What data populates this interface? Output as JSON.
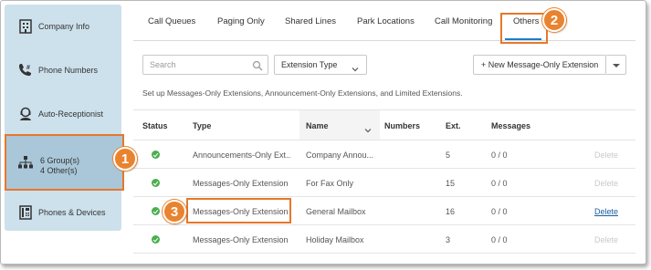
{
  "sidebar": {
    "items": [
      {
        "label": "Company Info",
        "icon": "building-icon"
      },
      {
        "label": "Phone Numbers",
        "icon": "phone-number-icon"
      },
      {
        "label": "Auto-Receptionist",
        "icon": "receptionist-icon"
      },
      {
        "label_line1": "6 Group(s)",
        "label_line2": "4 Other(s)",
        "icon": "org-chart-icon"
      },
      {
        "label": "Phones & Devices",
        "icon": "desk-phone-icon"
      }
    ]
  },
  "tabs": [
    "Call Queues",
    "Paging Only",
    "Shared Lines",
    "Park Locations",
    "Call Monitoring",
    "Others"
  ],
  "active_tab": "Others",
  "toolbar": {
    "search_placeholder": "Search",
    "filter_value": "Extension Type",
    "new_button": "+ New Message-Only Extension"
  },
  "description": "Set up Messages-Only Extensions, Announcement-Only Extensions, and Limited Extensions.",
  "table": {
    "headers": {
      "status": "Status",
      "type": "Type",
      "name": "Name",
      "numbers": "Numbers",
      "ext": "Ext.",
      "messages": "Messages"
    },
    "rows": [
      {
        "type": "Announcements-Only Ext...",
        "name": "Company Annou...",
        "numbers": "",
        "ext": "5",
        "messages": "0 / 0",
        "delete": "Delete",
        "delete_active": false
      },
      {
        "type": "Messages-Only Extension",
        "name": "For Fax Only",
        "numbers": "",
        "ext": "15",
        "messages": "0 / 0",
        "delete": "Delete",
        "delete_active": false
      },
      {
        "type": "Messages-Only Extension",
        "name": "General Mailbox",
        "numbers": "",
        "ext": "16",
        "messages": "0 / 0",
        "delete": "Delete",
        "delete_active": true
      },
      {
        "type": "Messages-Only Extension",
        "name": "Holiday Mailbox",
        "numbers": "",
        "ext": "3",
        "messages": "0 / 0",
        "delete": "Delete",
        "delete_active": false
      }
    ]
  },
  "markers": {
    "m1": "1",
    "m2": "2",
    "m3": "3"
  },
  "colors": {
    "accent": "#e7772c",
    "sidebar_bg": "#cde1ec",
    "status_ok": "#4bae4f",
    "link": "#1a5f9c"
  }
}
